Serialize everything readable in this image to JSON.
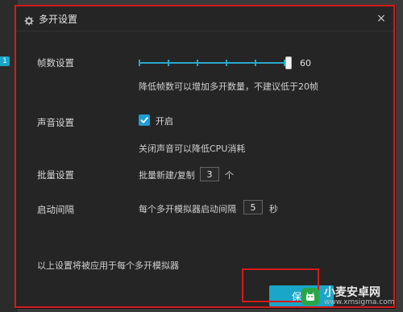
{
  "dialog": {
    "title": "多开设置"
  },
  "settings": {
    "fps": {
      "label": "帧数设置",
      "value": "60",
      "note": "降低帧数可以增加多开数量，不建议低于20帧"
    },
    "sound": {
      "label": "声音设置",
      "checkbox_label": "开启",
      "note": "关闭声音可以降低CPU消耗"
    },
    "batch": {
      "label": "批量设置",
      "text": "批量新建/复制",
      "value": "3",
      "unit": "个"
    },
    "interval": {
      "label": "启动间隔",
      "text": "每个多开模拟器启动间隔",
      "value": "5",
      "unit": "秒"
    }
  },
  "footer": {
    "note": "以上设置将被应用于每个多开模拟器",
    "save_label": "保存"
  },
  "watermark": {
    "title": "小麦安卓网",
    "url": "www.xmsigma.com"
  },
  "colors": {
    "accent": "#1aa6c8",
    "dialog_bg": "#252525",
    "highlight": "#d61a1a"
  }
}
